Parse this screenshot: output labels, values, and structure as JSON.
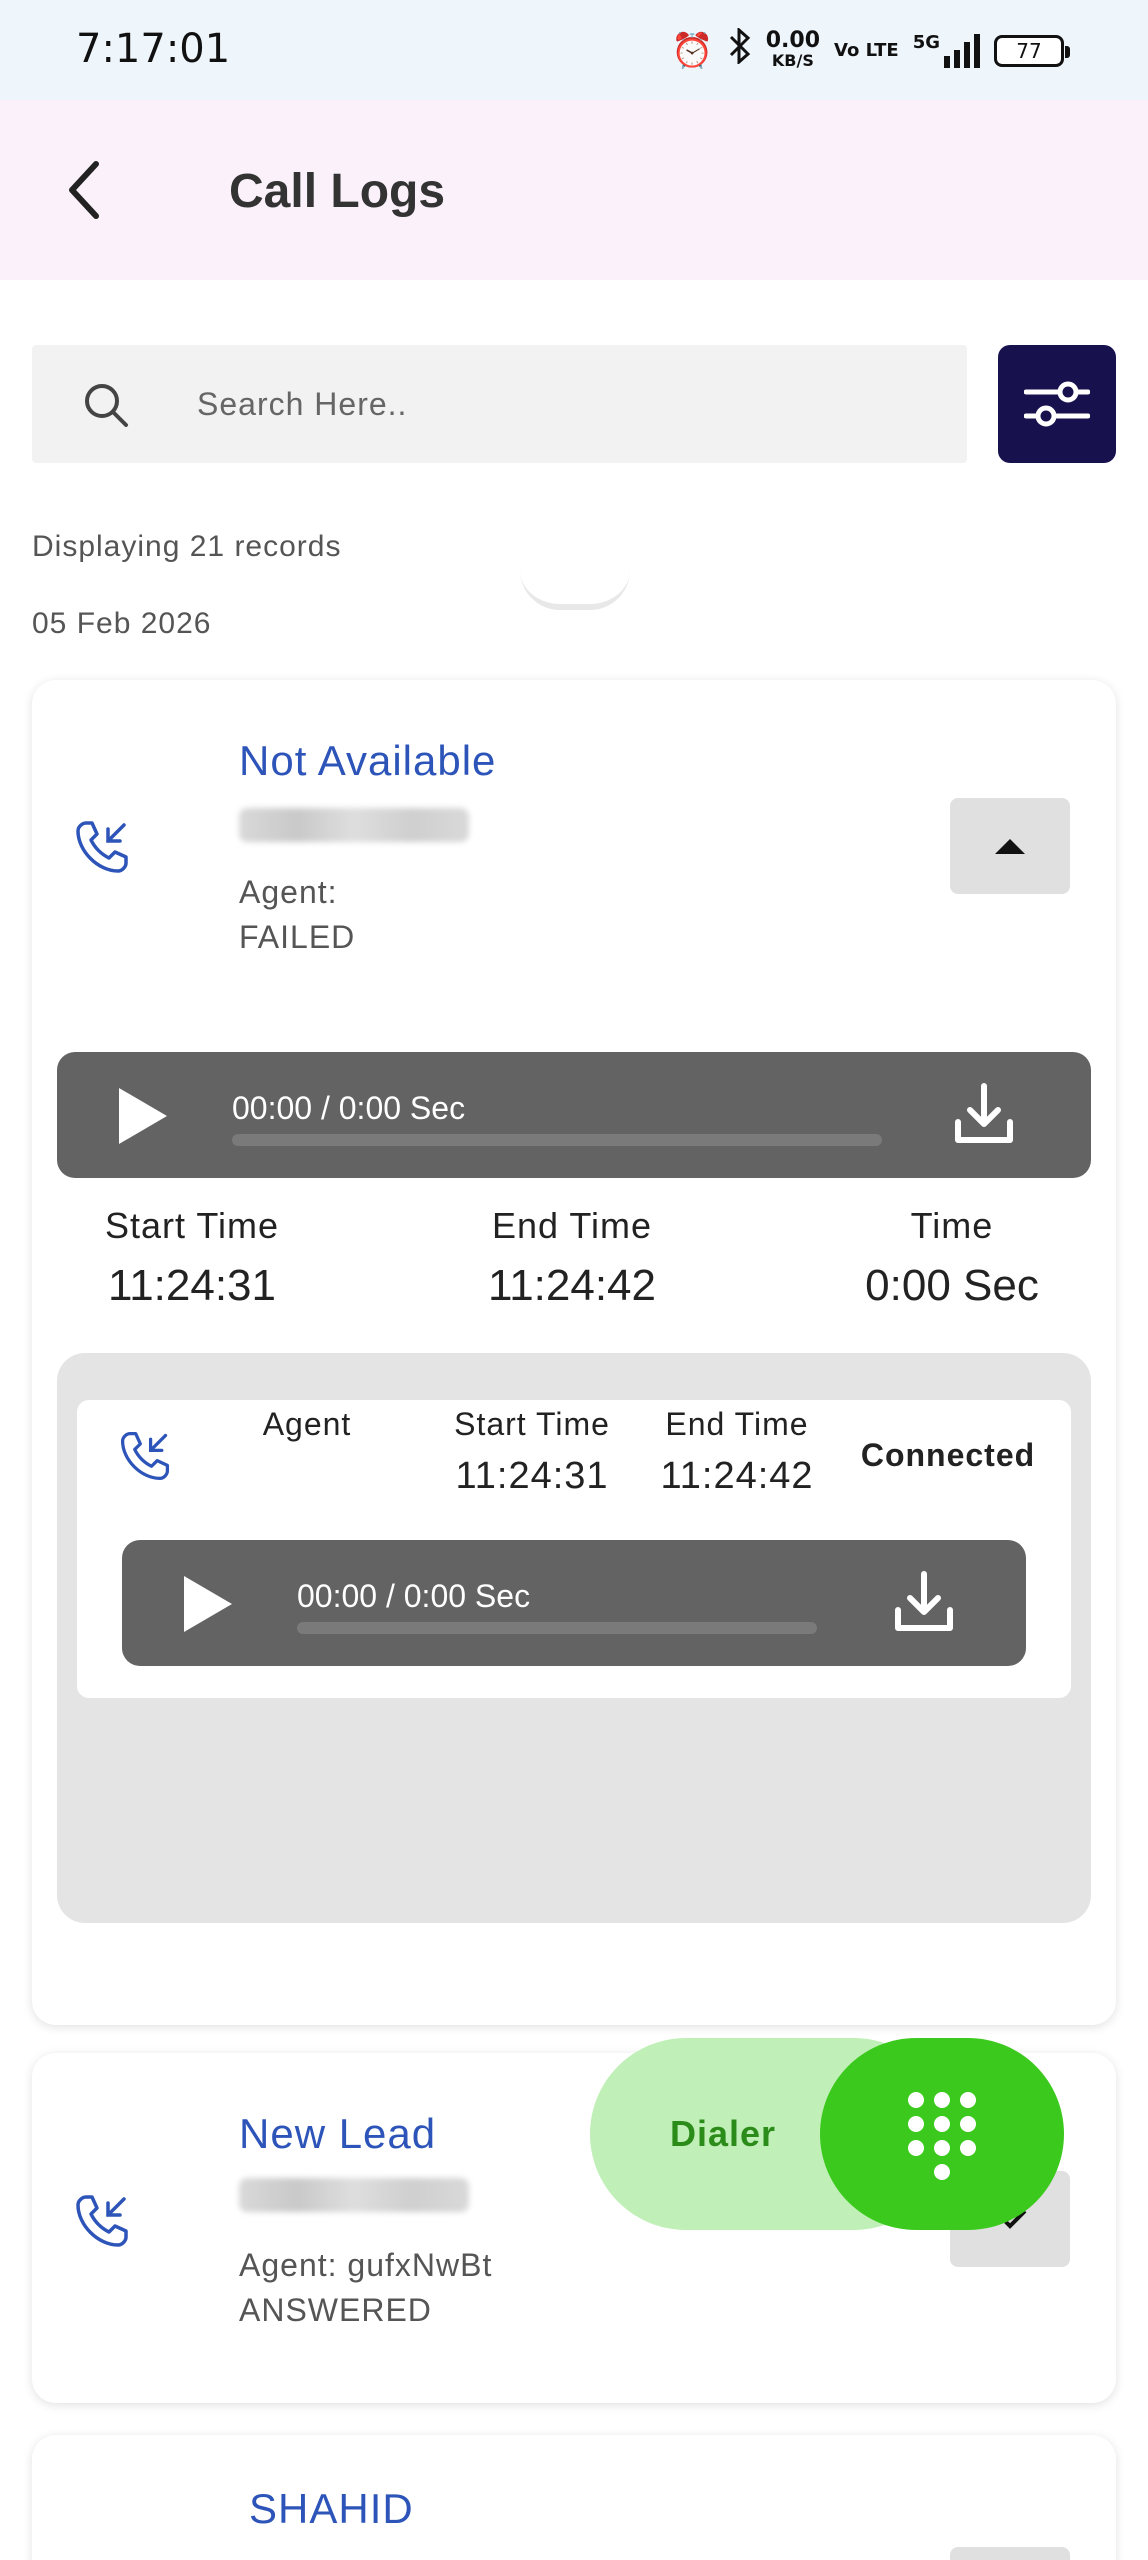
{
  "status_bar": {
    "time": "7:17:01",
    "net_speed": "0.00",
    "net_unit": "KB/S",
    "volte": "Vo LTE",
    "network": "5G",
    "battery": "77"
  },
  "header": {
    "title": "Call Logs",
    "back_icon": "back-arrow-icon"
  },
  "search": {
    "placeholder": "Search Here..",
    "value": "",
    "icon": "search-icon"
  },
  "filter": {
    "icon": "sliders-icon",
    "color": "#17124d"
  },
  "summary": {
    "records": "Displaying 21 records",
    "date": "05 Feb 2026"
  },
  "cards": [
    {
      "name": "Not Available",
      "agent": "Agent:",
      "status": "FAILED",
      "expanded": true,
      "player": {
        "time": "00:00 / 0:00 Sec",
        "progress": 0
      },
      "times": [
        {
          "label": "Start Time",
          "value": "11:24:31"
        },
        {
          "label": "End Time",
          "value": "11:24:42"
        },
        {
          "label": "Time",
          "value": "0:00 Sec"
        }
      ],
      "leg": {
        "agent_label": "Agent",
        "start_label": "Start Time",
        "start_value": "11:24:31",
        "end_label": "End Time",
        "end_value": "11:24:42",
        "status": "Connected",
        "player": {
          "time": "00:00 / 0:00 Sec",
          "progress": 0
        }
      }
    },
    {
      "name": "New Lead",
      "agent": "Agent: gufxNwBt",
      "status": "ANSWERED",
      "expanded": false
    },
    {
      "name": "SHAHID"
    }
  ],
  "fab": {
    "label": "Dialer",
    "icon": "dialpad-icon",
    "color": "#3cc91e"
  },
  "colors": {
    "accent_blue": "#2d54b8",
    "player_bg": "#636363",
    "header_bg": "#fbf1fa"
  }
}
